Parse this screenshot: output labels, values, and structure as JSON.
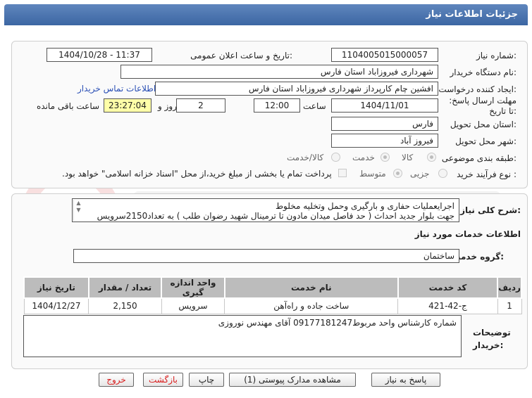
{
  "header": {
    "title": "جزئیات اطلاعات نیاز"
  },
  "labels": {
    "need_number": "شماره نیاز:",
    "announce_datetime": "تاریخ و ساعت اعلان عمومی:",
    "buyer_org": "نام دستگاه خریدار:",
    "requester": "ایجاد کننده درخواست:",
    "deadline": "مهلت ارسال پاسخ: تا تاریخ:",
    "time": "ساعت",
    "and": "روز و",
    "remaining": "ساعت باقی مانده",
    "delivery_province": "استان محل تحویل:",
    "delivery_city": "شهر محل تحویل:",
    "category": "طبقه بندی موضوعی:",
    "process_type": "نوع فرآیند خرید :",
    "general_desc": "شرح کلی نیاز:",
    "services_info": "اطلاعات خدمات مورد نیاز",
    "service_group": "گروه خدمت:",
    "buyer_notes": "توضیحات خریدار:"
  },
  "fields": {
    "need_number": "1104005015000057",
    "announce_datetime": "1404/10/28 - 11:37",
    "buyer_org": "شهرداری فیروزاباد استان فارس",
    "requester": "افشین چام کارپرداز شهرداری فیروزاباد استان فارس",
    "contact_link": "اطلاعات تماس خریدار",
    "deadline_date": "1404/11/01",
    "deadline_time": "12:00",
    "days": "2",
    "remaining_time": "23:27:04",
    "province": "فارس",
    "city": "فیروز آباد",
    "service_group": "ساختمان",
    "description_line1": "اجرایعملیات حفاری و بارگیری وحمل وتخلیه مخلوط",
    "description_line2": "جهت بلوار جدید احداث ( حد فاصل میدان مادون تا ترمینال شهید رضوان طلب ) به تعداد2150سرویس",
    "buyer_notes": "شماره کارشناس واحد مربوط09177181247 آقای مهندس نوروزی"
  },
  "category_options": [
    "کالا",
    "خدمت",
    "کالا/خدمت"
  ],
  "process_options": [
    "جزیی",
    "متوسط"
  ],
  "treasury_note": "پرداخت تمام یا بخشی از مبلغ خرید،از محل \"اسناد خزانه اسلامی\" خواهد بود.",
  "table": {
    "headers": [
      "ردیف",
      "کد خدمت",
      "نام خدمت",
      "واحد اندازه گیری",
      "تعداد / مقدار",
      "تاریخ نیاز"
    ],
    "rows": [
      [
        "1",
        "ج-42-421",
        "ساخت جاده و راه‌آهن",
        "سرویس",
        "2,150",
        "1404/12/27"
      ]
    ]
  },
  "buttons": {
    "reply": "پاسخ به نیاز",
    "attachments": "مشاهده مدارک پیوستی (1)",
    "print": "چاپ",
    "back": "بازگشت",
    "exit": "خروج"
  },
  "colors": {
    "header": "#4a72ad",
    "time_highlight": "#ffffa8",
    "link": "#2a4fb5",
    "danger": "#d81c1c"
  }
}
